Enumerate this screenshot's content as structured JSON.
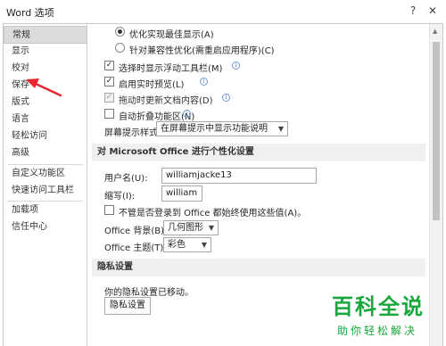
{
  "window": {
    "title": "Word 选项",
    "help_label": "?",
    "close_label": "✕"
  },
  "sidebar": {
    "items": [
      {
        "label": "常规",
        "active": true
      },
      {
        "label": "显示"
      },
      {
        "label": "校对"
      },
      {
        "label": "保存"
      },
      {
        "label": "版式"
      },
      {
        "label": "语言"
      },
      {
        "label": "轻松访问"
      },
      {
        "label": "高级"
      },
      {
        "label": "自定义功能区"
      },
      {
        "label": "快速访问工具栏"
      },
      {
        "label": "加载项"
      },
      {
        "label": "信任中心"
      }
    ]
  },
  "ui_options": {
    "radio_optimize": "优化实现最佳显示(A)",
    "radio_compat": "针对兼容性优化(需重启应用程序)(C)",
    "cb_minitoolbar": "选择时显示浮动工具栏(M)",
    "cb_livepreview": "启用实时预览(L)",
    "cb_dragupdate": "拖动时更新文档内容(D)",
    "cb_collapseribbon": "自动折叠功能区(N)",
    "screentip_label": "屏幕提示样式(R):",
    "screentip_value": "在屏幕提示中显示功能说明",
    "info_glyph": "i"
  },
  "personalize": {
    "header": "对 Microsoft Office 进行个性化设置",
    "username_label": "用户名(U):",
    "username_value": "williamjacke13",
    "initials_label": "缩写(I):",
    "initials_value": "william",
    "always_use_label": "不管是否登录到 Office 都始终使用这些值(A)。",
    "background_label": "Office 背景(B):",
    "background_value": "几何图形",
    "theme_label": "Office 主题(T):",
    "theme_value": "彩色"
  },
  "privacy": {
    "header": "隐私设置",
    "moved_text": "你的隐私设置已移动。",
    "button_label": "隐私设置"
  },
  "watermark": {
    "big": "百科全说",
    "small": "助你轻松解决"
  },
  "colors": {
    "arrow": "#e8262f",
    "watermark": "#18a83c",
    "section_bg": "#f0f0f0"
  }
}
